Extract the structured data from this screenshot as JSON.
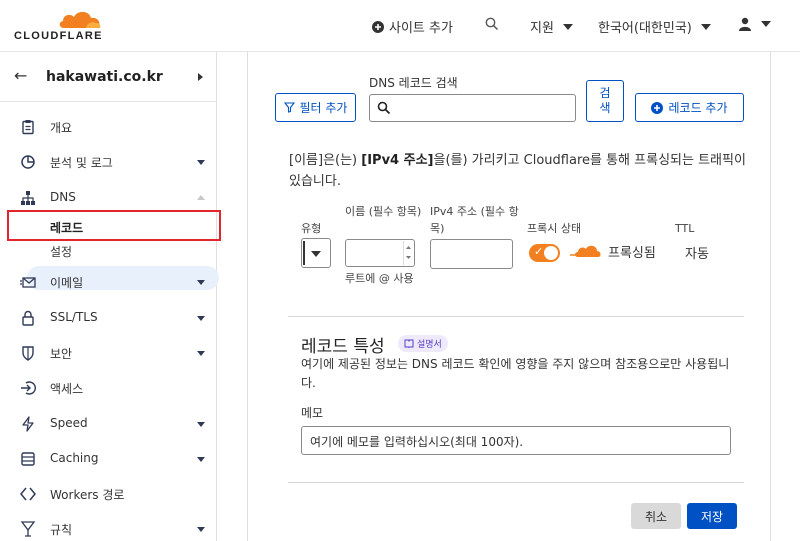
{
  "header": {
    "logo_text": "CLOUDFLARE",
    "add_site": "사이트 추가",
    "support": "지원",
    "language": "한국어(대한민국)"
  },
  "sidebar": {
    "zone_name": "hakawati.co.kr",
    "items": [
      {
        "label": "개요",
        "icon": "clipboard-icon"
      },
      {
        "label": "분석 및 로그",
        "icon": "analytics-icon"
      },
      {
        "label": "DNS",
        "icon": "dns-network-icon"
      },
      {
        "label": "이메일",
        "icon": "email-icon"
      },
      {
        "label": "SSL/TLS",
        "icon": "lock-icon"
      },
      {
        "label": "보안",
        "icon": "shield-icon"
      },
      {
        "label": "액세스",
        "icon": "access-icon"
      },
      {
        "label": "Speed",
        "icon": "lightning-icon"
      },
      {
        "label": "Caching",
        "icon": "caching-icon"
      },
      {
        "label": "Workers 경로",
        "icon": "workers-icon"
      },
      {
        "label": "규칙",
        "icon": "rules-icon"
      }
    ],
    "dns_sub": {
      "records": "레코드",
      "settings": "설정"
    }
  },
  "toolbar": {
    "filter_label": "필터 추가",
    "search_label": "DNS 레코드 검색",
    "search_button": "검색",
    "add_record": "레코드 추가"
  },
  "form": {
    "description_prefix": "[이름]은(는) ",
    "description_bold": "[IPv4 주소]",
    "description_suffix": "을(를) 가리키고 Cloudflare를 통해 프록싱되는 트래픽이 있습니다.",
    "type_label": "유형",
    "name_label": "이름 (필수 항목)",
    "name_hint": "루트에 @ 사용",
    "ipv4_label": "IPv4 주소 (필수 항목)",
    "proxy_label": "프록시 상태",
    "proxy_value": "프록싱됨",
    "ttl_label": "TTL",
    "ttl_value": "자동"
  },
  "record_attributes": {
    "title": "레코드 특성",
    "docs_badge": "설명서",
    "description": "여기에 제공된 정보는 DNS 레코드 확인에 영향을 주지 않으며 참조용으로만 사용됩니다.",
    "memo_label": "메모",
    "memo_placeholder": "여기에 메모를 입력하십시오(최대 100자)."
  },
  "actions": {
    "cancel": "취소",
    "save": "저장"
  },
  "colors": {
    "accent": "#0051c3",
    "brand_orange": "#f38020",
    "highlight_red": "#e3242b"
  }
}
